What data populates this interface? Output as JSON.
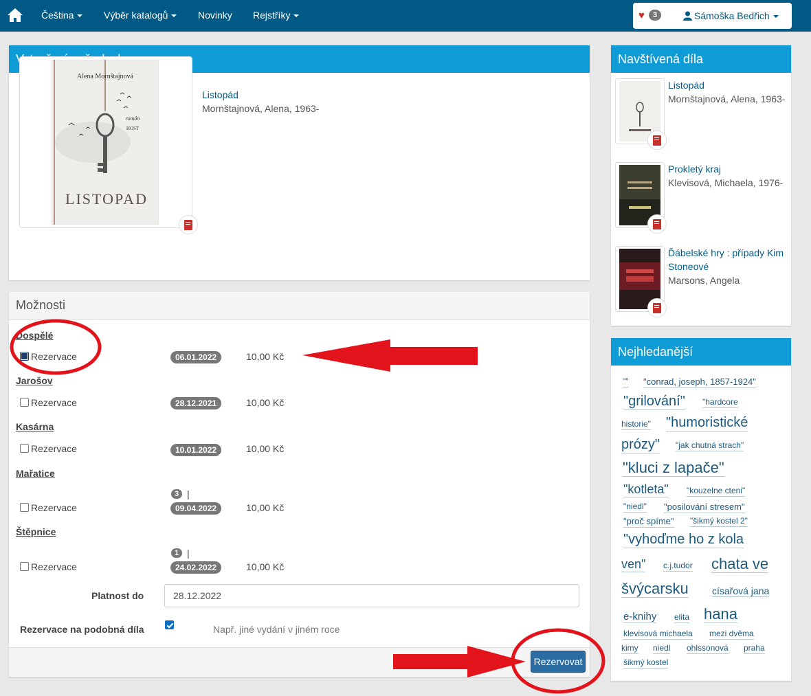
{
  "nav": {
    "items": [
      "Čeština",
      "Výběr katalogů",
      "Novinky",
      "Rejstříky"
    ],
    "favorites_count": "3",
    "user_name": "Sámoška Bedřich"
  },
  "request": {
    "title": "Vytvoření požadavku",
    "book_title": "Listopád",
    "book_author": "Mornštajnová, Alena, 1963-",
    "cover": {
      "author": "Alena Mornštajnová",
      "word": "román",
      "publisher": "HOST",
      "title": "LISTOPAD"
    }
  },
  "options": {
    "title": "Možnosti",
    "reserve_label": "Rezervace",
    "libraries": [
      {
        "name": "Dospělé",
        "checked": true,
        "date": "06.01.2022",
        "price": "10,00 Kč",
        "queue": ""
      },
      {
        "name": "Jarošov",
        "checked": false,
        "date": "28.12.2021",
        "price": "10,00 Kč",
        "queue": ""
      },
      {
        "name": "Kasárna",
        "checked": false,
        "date": "10.01.2022",
        "price": "10,00 Kč",
        "queue": ""
      },
      {
        "name": "Mařatice",
        "checked": false,
        "date": "09.04.2022",
        "price": "10,00 Kč",
        "queue": "3"
      },
      {
        "name": "Štěpnice",
        "checked": false,
        "date": "24.02.2022",
        "price": "10,00 Kč",
        "queue": "1"
      }
    ],
    "queue_separator": "|",
    "validity_label": "Platnost do",
    "validity_value": "28.12.2022",
    "similar_label": "Rezervace na podobná díla",
    "similar_hint": "Např. jiné vydání v jiném roce",
    "submit_label": "Rezervovat"
  },
  "visited": {
    "title": "Navštívená díla",
    "items": [
      {
        "title": "Listopád",
        "author": "Mornštajnová, Alena, 1963-"
      },
      {
        "title": "Prokletý kraj",
        "author": "Klevisová, Michaela, 1976-"
      },
      {
        "title": "Ďábelské hry : případy Kim Stoneové",
        "author": "Marsons, Angela"
      }
    ]
  },
  "popular": {
    "title": "Nejhledanější",
    "tags": [
      "\"\"",
      "\"conrad, joseph, 1857-1924\"",
      "\"grilování\"",
      "\"hardcore",
      "historie\"",
      "\"humoristické",
      "prózy\"",
      "\"jak chutná strach\"",
      "\"kluci z lapače\"",
      "\"kotleta\"",
      "\"kouzelne cteni\"",
      "\"niedl\"",
      "\"posilování stresem\"",
      "\"proč spíme\"",
      "\"šikmý kostel 2\"",
      "\"vyhoďme ho z kola",
      "ven\"",
      "c.j.tudor",
      "chata ve",
      "švýcarsku",
      "císařová jana",
      "e-knihy",
      "elita",
      "hana",
      "klevisová michaela",
      "mezi dvěma",
      "kimy",
      "niedl",
      "ohlssonová",
      "praha",
      "šikmý kostel"
    ]
  }
}
